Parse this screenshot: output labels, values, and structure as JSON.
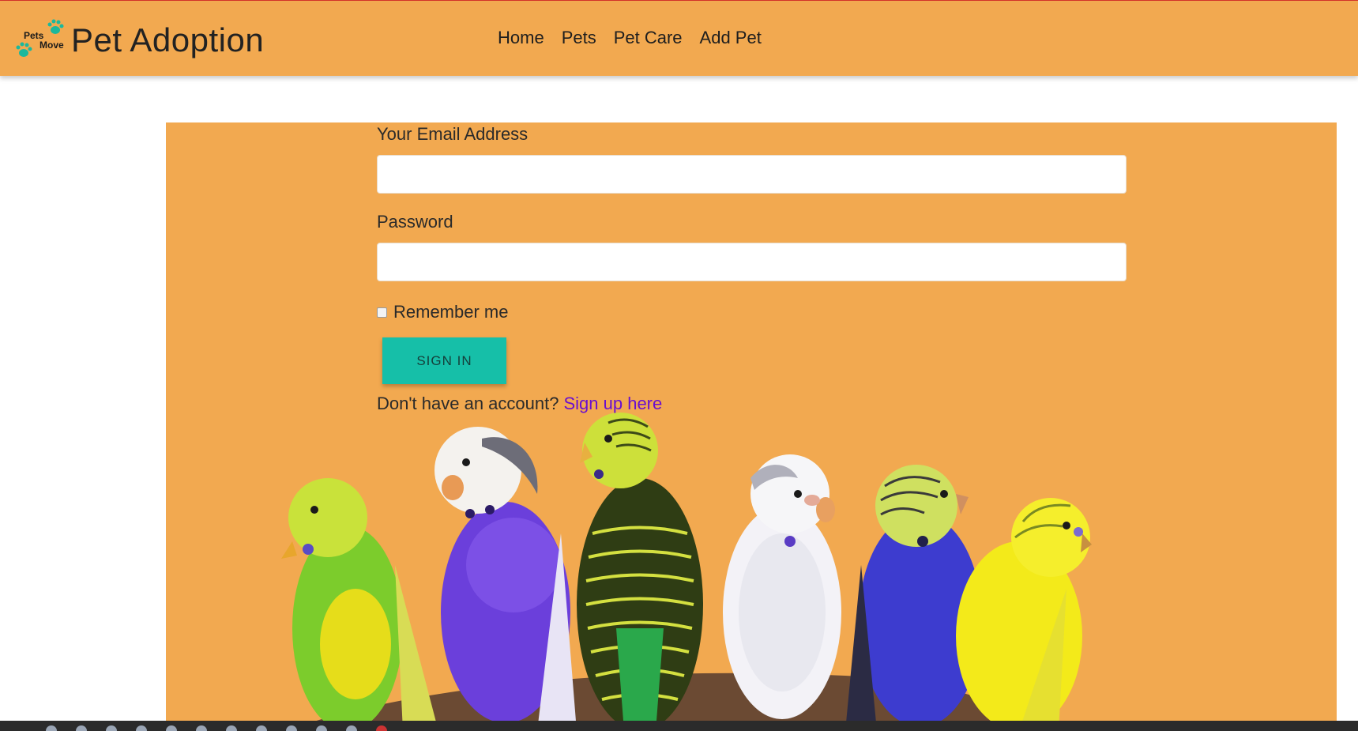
{
  "brand": {
    "logo_text_top": "Pets",
    "logo_text_bottom": "Move",
    "title": "Pet Adoption"
  },
  "nav": {
    "items": [
      "Home",
      "Pets",
      "Pet Care",
      "Add Pet"
    ]
  },
  "form": {
    "email_label": "Your Email Address",
    "email_value": "",
    "password_label": "Password",
    "password_value": "",
    "remember_label": "Remember me",
    "remember_checked": false,
    "signin_label": "SIGN IN",
    "signup_prompt": "Don't have an account?",
    "signup_link": "Sign up here"
  },
  "image": {
    "subject": "budgerigars-on-perch"
  },
  "colors": {
    "primary": "#f2a950",
    "accent": "#16bfa8",
    "link": "#6a0fcf"
  }
}
